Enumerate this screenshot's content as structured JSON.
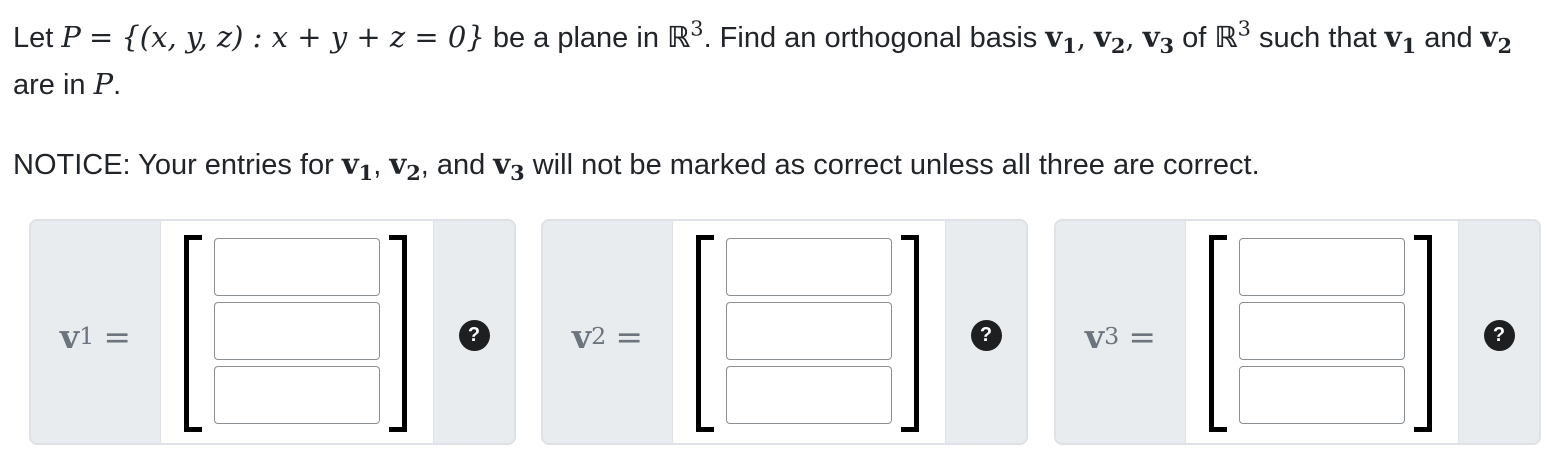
{
  "question": {
    "t_let": "Let",
    "plane_name": "P",
    "t_eq": "=",
    "set_expr": "{(x, y, z) : x + y + z = 0}",
    "t_be_plane": "be a plane in",
    "space": "ℝ",
    "space_exp": "3",
    "t_find": ". Find an orthogonal basis",
    "t_v": "v",
    "s1": "1",
    "s2": "2",
    "s3": "3",
    "comma": ",",
    "t_of": "of",
    "t_such_that": "such that",
    "t_and": "and",
    "t_are_in": "are in",
    "t_period": "."
  },
  "notice": {
    "t_prefix": "NOTICE: Your entries for",
    "t_comma": ",",
    "t_and": ", and",
    "t_suffix": "will not be marked as correct unless all three are correct."
  },
  "answers": [
    {
      "var": "v",
      "sub": "1",
      "eq": "=",
      "entries": [
        "",
        "",
        ""
      ],
      "help": "?"
    },
    {
      "var": "v",
      "sub": "2",
      "eq": "=",
      "entries": [
        "",
        "",
        ""
      ],
      "help": "?"
    },
    {
      "var": "v",
      "sub": "3",
      "eq": "=",
      "entries": [
        "",
        "",
        ""
      ],
      "help": "?"
    }
  ]
}
